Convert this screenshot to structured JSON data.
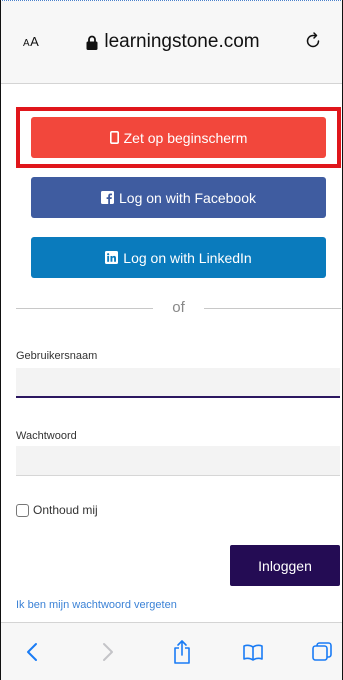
{
  "browser": {
    "text_size_label": "AA",
    "url": "learningstone.com"
  },
  "buttons": {
    "home_screen": "Zet op beginscherm",
    "facebook": "Log on with Facebook",
    "linkedin": "Log on with LinkedIn"
  },
  "divider_text": "of",
  "form": {
    "username_label": "Gebruikersnaam",
    "username_value": "",
    "password_label": "Wachtwoord",
    "password_value": "",
    "remember_label": "Onthoud mij",
    "remember_checked": false,
    "login_label": "Inloggen",
    "forgot_link": "Ik ben mijn wachtwoord vergeten"
  },
  "toolbar": {
    "icons": [
      "back-icon",
      "forward-icon",
      "share-icon",
      "bookmarks-icon",
      "tabs-icon"
    ]
  },
  "colors": {
    "highlight": "#e0161b",
    "home_button": "#f2473c",
    "facebook": "#3f5ca0",
    "linkedin": "#0a7bbd",
    "login": "#240c54",
    "link": "#3b82d6",
    "ios_blue": "#1a7cf5"
  }
}
